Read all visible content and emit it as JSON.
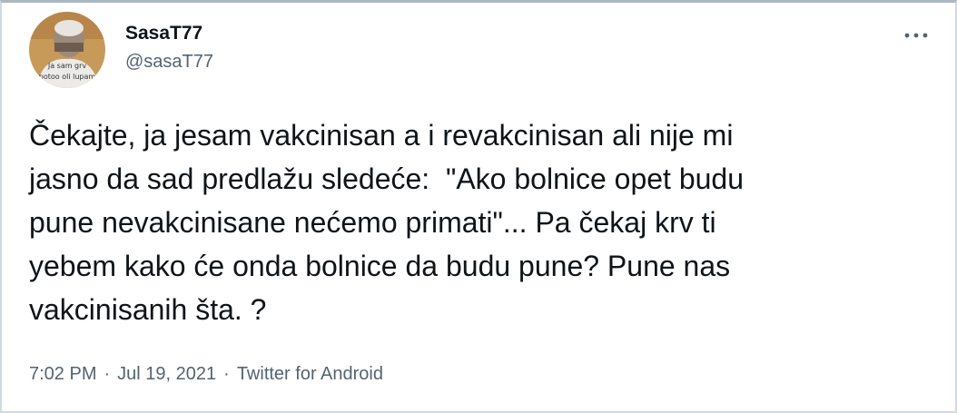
{
  "tweet": {
    "display_name": "SasaT77",
    "handle": "@sasaT77",
    "more_icon": "more-horizontal-icon",
    "avatar_caption_line1": "Ja sam grv",
    "avatar_caption_line2": "potoo oli lupam",
    "text_line1": "Čekajte, ja jesam vakcinisan a i revakcinisan ali nije mi",
    "text_line2": "jasno da sad predlažu sledeće:  \"Ako bolnice opet budu",
    "text_line3": "pune nevakcinisane nećemo primati\"... Pa čekaj krv ti",
    "text_line4": "yebem kako će onda bolnice da budu pune? Pune nas",
    "text_line5": "vakcinisanih šta. ?",
    "time": "7:02 PM",
    "separator": "·",
    "date": "Jul 19, 2021",
    "source": "Twitter for Android"
  }
}
